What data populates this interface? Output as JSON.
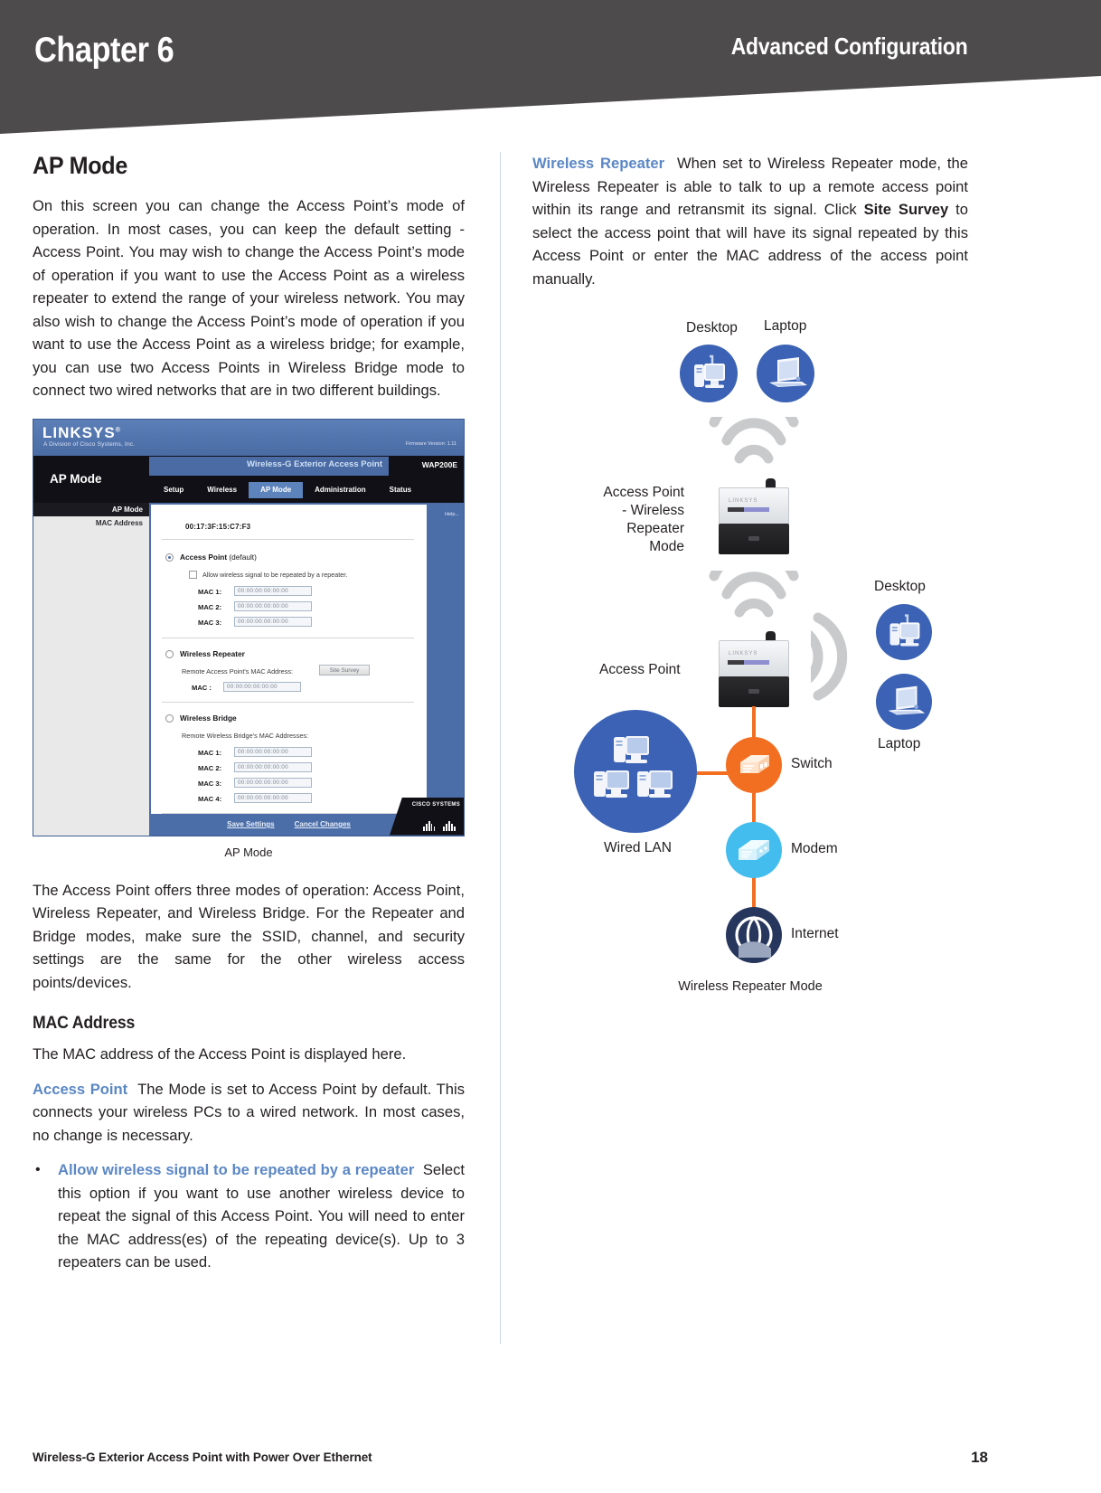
{
  "header": {
    "chapter": "Chapter 6",
    "section": "Advanced Configuration"
  },
  "left_column": {
    "title": "AP Mode",
    "intro_paragraph": "On this screen you can change the Access Point’s mode of operation. In most cases, you can keep the default setting - Access Point. You may wish to change the Access Point’s mode of operation if you want to use the Access Point as a wireless repeater to extend the range of your wireless network. You may also wish to change the Access Point’s mode of operation if you want to use the Access Point as a wireless bridge; for example, you can use two Access Points in Wireless Bridge mode to connect two wired networks that are in two different buildings.",
    "figure_caption": "AP Mode",
    "modes_paragraph": "The Access Point offers three modes of operation: Access Point, Wireless Repeater, and Wireless Bridge. For the Repeater and Bridge modes, make sure the SSID, channel, and security settings are the same for the other wireless access points/devices.",
    "mac_address_heading": "MAC Address",
    "mac_address_paragraph": "The MAC address of the Access Point is displayed here.",
    "access_point_term": "Access Point",
    "access_point_paragraph": "The Mode is set to Access Point by default. This connects your wireless PCs to a wired network. In most cases, no change is necessary.",
    "bullet": {
      "term": "Allow wireless signal to be repeated by a repeater",
      "text": "Select this option if you want to use another wireless device to repeat the signal of this Access Point. You will need to enter the MAC address(es) of the repeating device(s). Up to 3 repeaters can be used."
    }
  },
  "right_column": {
    "repeater_term": "Wireless Repeater",
    "repeater_text_1": "When set to Wireless Repeater mode, the Wireless Repeater is able to talk to up a remote access point within its range and retransmit its signal. Click ",
    "repeater_bold_1": "Site Survey",
    "repeater_text_2": " to select the access point that will have its signal repeated by this Access Point or enter the MAC address of the access point manually."
  },
  "screenshot": {
    "brand": "LINKSYS",
    "brand_reg": "®",
    "brand_sub": "A Division of Cisco Systems, Inc.",
    "firmware": "Firmware Version: 1.11",
    "product_name": "Wireless-G Exterior Access Point",
    "model": "WAP200E",
    "screen_title": "AP Mode",
    "tabs": [
      {
        "label": "Setup",
        "active": false
      },
      {
        "label": "Wireless",
        "active": false
      },
      {
        "label": "AP Mode",
        "active": true
      },
      {
        "label": "Administration",
        "active": false
      },
      {
        "label": "Status",
        "active": false
      }
    ],
    "sidebar_head": "AP Mode",
    "sidebar_item": "MAC Address",
    "mac_value": "00:17:3F:15:C7:F3",
    "option_ap_label": "Access Point",
    "option_ap_default": " (default)",
    "checkbox_repeat_label": "Allow wireless signal to be repeated by a repeater.",
    "ap_mac_fields": [
      {
        "label": "MAC 1:",
        "value": "00:00:00:00:00:00"
      },
      {
        "label": "MAC 2:",
        "value": "00:00:00:00:00:00"
      },
      {
        "label": "MAC 3:",
        "value": "00:00:00:00:00:00"
      }
    ],
    "option_repeater_label": "Wireless Repeater",
    "repeater_sub_label": "Remote Access Point's MAC Address:",
    "site_survey_button": "Site Survey",
    "repeater_mac_field": {
      "label": "MAC :",
      "value": "00:00:00:00:00:00"
    },
    "option_bridge_label": "Wireless Bridge",
    "bridge_sub_label": "Remote Wireless Bridge's MAC Addresses:",
    "bridge_mac_fields": [
      {
        "label": "MAC 1:",
        "value": "00:00:00:00:00:00"
      },
      {
        "label": "MAC 2:",
        "value": "00:00:00:00:00:00"
      },
      {
        "label": "MAC 3:",
        "value": "00:00:00:00:00:00"
      },
      {
        "label": "MAC 4:",
        "value": "00:00:00:00:00:00"
      }
    ],
    "help_text": "Help...",
    "save_button": "Save Settings",
    "cancel_button": "Cancel Changes",
    "cisco_text": "CISCO SYSTEMS"
  },
  "diagram": {
    "labels": {
      "desktop_top": "Desktop",
      "laptop_top": "Laptop",
      "ap_repeater": "Access Point\n- Wireless\nRepeater\nMode",
      "ap_repeater_l1": "Access Point",
      "ap_repeater_l2": "- Wireless",
      "ap_repeater_l3": "Repeater",
      "ap_repeater_l4": "Mode",
      "desktop_right": "Desktop",
      "laptop_right": "Laptop",
      "access_point": "Access Point",
      "switch": "Switch",
      "wired_lan": "Wired LAN",
      "modem": "Modem",
      "internet": "Internet"
    },
    "caption": "Wireless Repeater Mode",
    "colors": {
      "device_blue": "#3b62b4",
      "switch_orange": "#f26f21",
      "modem_cyan": "#43bdee",
      "internet_navy": "#27365c",
      "wifi_gray": "#c9cacc"
    }
  },
  "footer": {
    "product": "Wireless-G Exterior Access Point with Power Over Ethernet",
    "page_number": "18"
  }
}
